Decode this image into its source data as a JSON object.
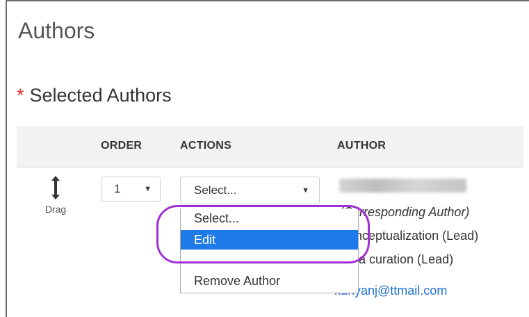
{
  "page": {
    "title": "Authors",
    "section_required_mark": "*",
    "section_title": "Selected Authors"
  },
  "table": {
    "columns": [
      "ORDER",
      "ACTIONS",
      "AUTHOR"
    ]
  },
  "row": {
    "drag_label": "Drag",
    "order_value": "1",
    "action_value": "Select...",
    "author_role": "(Corresponding Author)",
    "contributions": [
      "Conceptualization (Lead)",
      "Data curation (Lead)"
    ],
    "email": "kuriyanj@ttmail.com"
  },
  "actions_dropdown": {
    "options": [
      "Select...",
      "Edit",
      "Remove Author"
    ],
    "highlighted": "Edit"
  },
  "colors": {
    "required": "#d9322f",
    "highlight": "#1e7ae8",
    "ring": "#a12fd6",
    "link": "#1f6fd1"
  }
}
